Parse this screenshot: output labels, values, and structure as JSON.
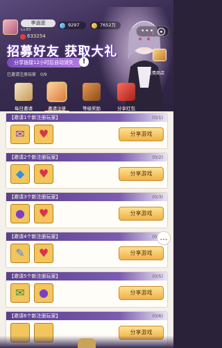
{
  "player": {
    "name": "李逍遥",
    "level": "Lv.83",
    "power": "633254",
    "gems": "9297",
    "coins": "7652万"
  },
  "banner": {
    "title": "招募好友 获取大礼",
    "subtitle": "分享链接12小时后自动消失",
    "progress_label": "已邀请注册玩家",
    "progress_value": "0/9",
    "shop_label": "友情商店"
  },
  "tabs": [
    {
      "label": "每日邀请",
      "icon": "calendar-icon"
    },
    {
      "label": "邀请注册",
      "icon": "invite-letter-icon",
      "active": true
    },
    {
      "label": "等级奖励",
      "icon": "chest-icon"
    },
    {
      "label": "分享红包",
      "icon": "red-envelope-icon"
    }
  ],
  "cards": [
    {
      "title": "【邀请1个新注册玩家】",
      "count": "(0/1)",
      "button": "分享游戏",
      "rewards": [
        {
          "glyph": "✉",
          "icon": "purple-letter-icon"
        },
        {
          "glyph": "♥",
          "icon": "red-token-icon"
        }
      ]
    },
    {
      "title": "【邀请2个新注册玩家】",
      "count": "(0/2)",
      "button": "分享游戏",
      "rewards": [
        {
          "glyph": "◆",
          "icon": "blue-gem-icon"
        },
        {
          "glyph": "♥",
          "icon": "red-token-icon"
        }
      ]
    },
    {
      "title": "【邀请3个新注册玩家】",
      "count": "(0/3)",
      "button": "分享游戏",
      "rewards": [
        {
          "glyph": "●",
          "icon": "gold-coin-icon"
        },
        {
          "glyph": "♥",
          "icon": "red-token-icon"
        }
      ]
    },
    {
      "title": "【邀请4个新注册玩家】",
      "count": "(0/4)",
      "button": "分享游戏",
      "rewards": [
        {
          "glyph": "✎",
          "icon": "scroll-icon"
        },
        {
          "glyph": "♥",
          "icon": "red-token-icon"
        }
      ]
    },
    {
      "title": "【邀请5个新注册玩家】",
      "count": "(0/5)",
      "button": "分享游戏",
      "rewards": [
        {
          "glyph": "✉",
          "icon": "green-scroll-icon"
        },
        {
          "glyph": "●",
          "icon": "gold-coin-icon"
        }
      ]
    },
    {
      "title": "【邀请6个新注册玩家】",
      "count": "(0/6)",
      "button": "分享游戏",
      "rewards": [
        {
          "glyph": "",
          "icon": "reward-icon"
        },
        {
          "glyph": "",
          "icon": "reward-icon"
        }
      ]
    }
  ],
  "info_icon_glyph": "!",
  "chat_glyph": "…"
}
